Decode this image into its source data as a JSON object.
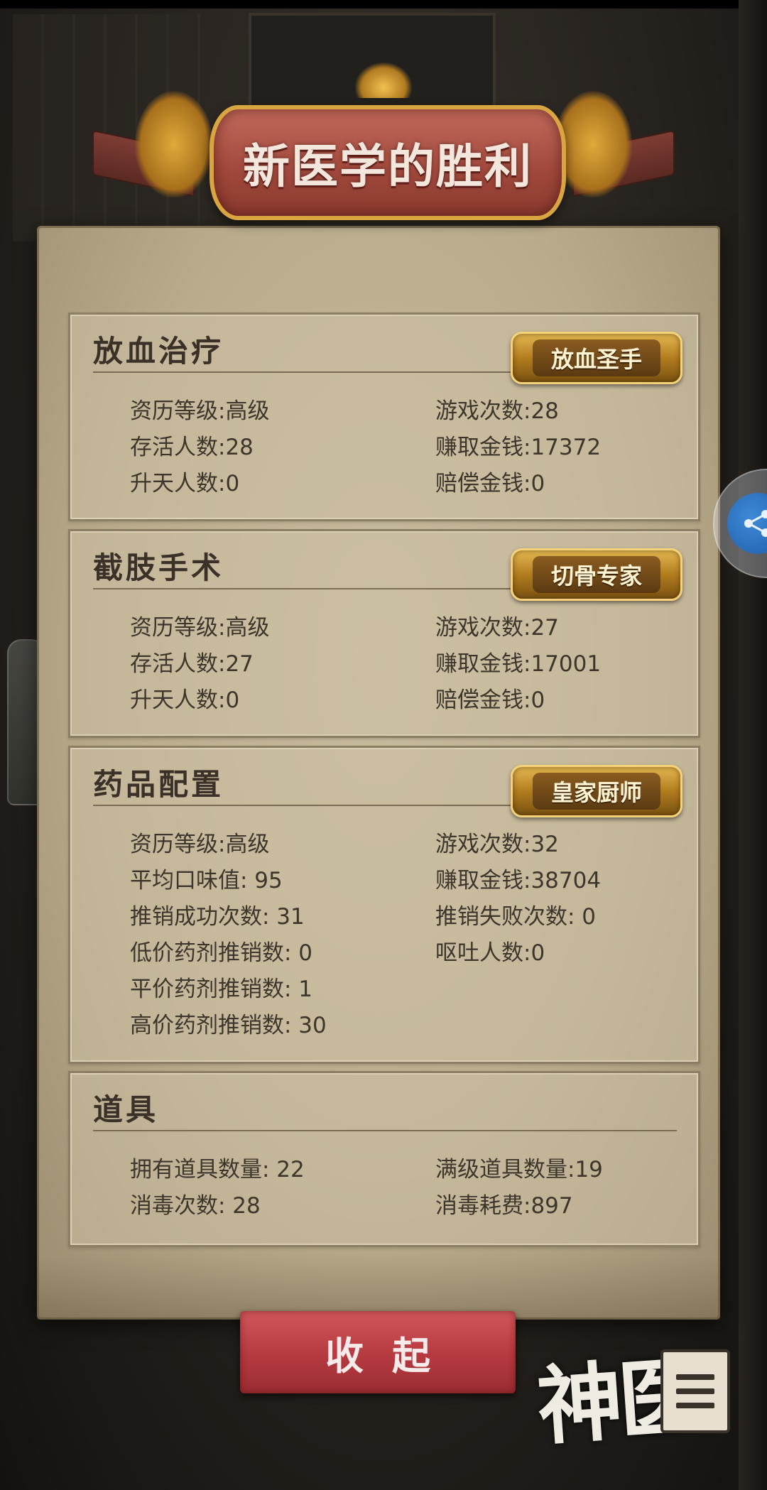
{
  "banner": {
    "title": "新医学的胜利"
  },
  "sections": [
    {
      "title": "放血治疗",
      "badge": "放血圣手",
      "stats": [
        [
          "资历等级:高级",
          "游戏次数:28"
        ],
        [
          "存活人数:28",
          "赚取金钱:17372"
        ],
        [
          "升天人数:0",
          "赔偿金钱:0"
        ]
      ]
    },
    {
      "title": "截肢手术",
      "badge": "切骨专家",
      "stats": [
        [
          "资历等级:高级",
          "游戏次数:27"
        ],
        [
          "存活人数:27",
          "赚取金钱:17001"
        ],
        [
          "升天人数:0",
          "赔偿金钱:0"
        ]
      ]
    },
    {
      "title": "药品配置",
      "badge": "皇家厨师",
      "stats": [
        [
          "资历等级:高级",
          "游戏次数:32"
        ],
        [
          "平均口味值: 95",
          "赚取金钱:38704"
        ],
        [
          "推销成功次数: 31",
          "推销失败次数: 0"
        ],
        [
          "低价药剂推销数: 0",
          "呕吐人数:0"
        ],
        [
          "平价药剂推销数: 1",
          ""
        ],
        [
          "高价药剂推销数: 30",
          ""
        ]
      ]
    },
    {
      "title": "道具",
      "stats": [
        [
          "拥有道具数量: 22",
          "满级道具数量:19"
        ],
        [
          "消毒次数: 28",
          "消毒耗费:897"
        ]
      ]
    }
  ],
  "buttons": {
    "collapse": "收起"
  },
  "logo": {
    "text": "神医"
  },
  "icons": {
    "share": "share-icon",
    "menu": "list-menu-icon"
  }
}
